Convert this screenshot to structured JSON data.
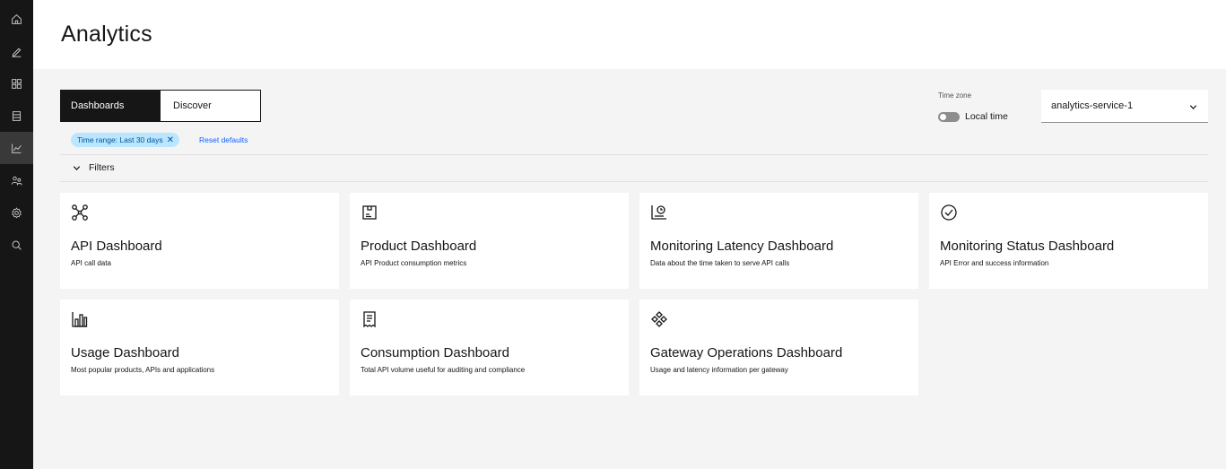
{
  "rail": {
    "items": [
      {
        "icon": "home-icon"
      },
      {
        "icon": "edit-icon"
      },
      {
        "icon": "apps-icon"
      },
      {
        "icon": "catalog-icon"
      },
      {
        "icon": "analytics-icon",
        "active": true
      },
      {
        "icon": "users-icon"
      },
      {
        "icon": "settings-icon"
      },
      {
        "icon": "search-icon"
      }
    ]
  },
  "header": {
    "title": "Analytics"
  },
  "view_switcher": {
    "dashboards": "Dashboards",
    "discover": "Discover"
  },
  "filter_tag": {
    "label": "Time range: Last 30 days",
    "close": "✕"
  },
  "reset_link": "Reset defaults",
  "filters_label": "Filters",
  "timezone": {
    "label": "Time zone",
    "toggle_label": "Local time",
    "toggle_on": false
  },
  "service_select": {
    "value": "analytics-service-1"
  },
  "cards": [
    {
      "icon": "api-network-icon",
      "title": "API Dashboard",
      "desc": "API call data"
    },
    {
      "icon": "product-box-icon",
      "title": "Product Dashboard",
      "desc": "API Product consumption metrics"
    },
    {
      "icon": "latency-chart-icon",
      "title": "Monitoring Latency Dashboard",
      "desc": "Data about the time taken to serve API calls"
    },
    {
      "icon": "checkmark-circle-icon",
      "title": "Monitoring Status Dashboard",
      "desc": "API Error and success information"
    },
    {
      "icon": "bar-chart-icon",
      "title": "Usage Dashboard",
      "desc": "Most popular products, APIs and applications"
    },
    {
      "icon": "receipt-icon",
      "title": "Consumption Dashboard",
      "desc": "Total API volume useful for auditing and compliance"
    },
    {
      "icon": "gateway-icon",
      "title": "Gateway Operations Dashboard",
      "desc": "Usage and latency information per gateway"
    }
  ],
  "colors": {
    "rail_bg": "#161616",
    "main_bg": "#f4f4f4",
    "tag_bg": "#bae6ff",
    "link": "#0f62fe"
  }
}
